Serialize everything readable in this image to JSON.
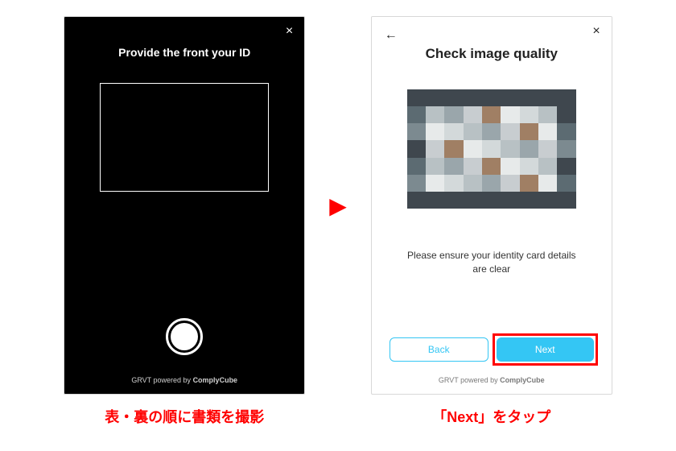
{
  "left": {
    "close": "×",
    "title": "Provide the front your ID",
    "footer_prefix": "GRVT powered by ",
    "footer_brand": "ComplyCube",
    "caption": "表・裏の順に書類を撮影"
  },
  "right": {
    "back": "←",
    "close": "×",
    "title": "Check image quality",
    "instruction_line1": "Please ensure your identity card details",
    "instruction_line2": "are clear",
    "back_label": "Back",
    "next_label": "Next",
    "footer_prefix": "GRVT powered by ",
    "footer_brand": "ComplyCube",
    "caption": "「Next」をタップ"
  },
  "arrow_glyph": "▶",
  "colors": {
    "accent": "#34c6f4",
    "highlight": "#ff0000"
  },
  "mosaic_palette": [
    "#3f474e",
    "#5c6b72",
    "#7c8a90",
    "#9aa6ab",
    "#b8c1c4",
    "#d3d9da",
    "#e7eaea",
    "#a07f64",
    "#c8cdd0"
  ]
}
